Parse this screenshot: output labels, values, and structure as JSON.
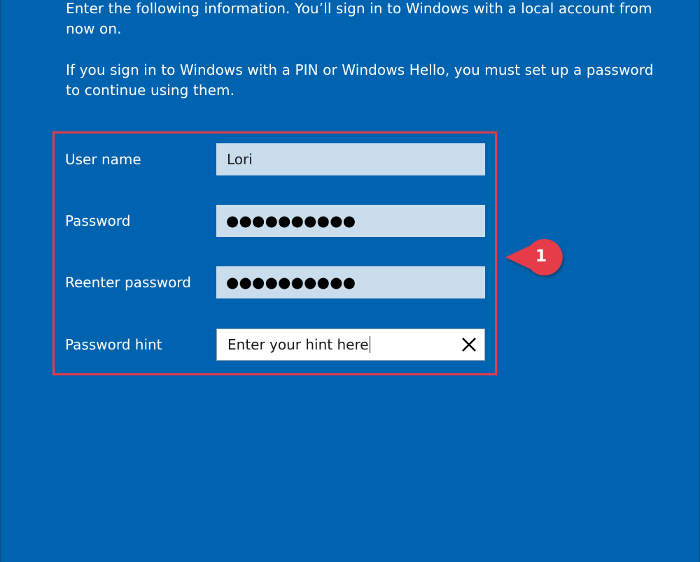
{
  "intro": {
    "paragraph1": "Enter the following information. You’ll sign in to Windows with a local account from now on.",
    "paragraph2": "If you sign in to Windows with a PIN or Windows Hello, you must set up a password to continue using them."
  },
  "form": {
    "username": {
      "label": "User name",
      "value": "Lori"
    },
    "password": {
      "label": "Password",
      "masked_value": "●●●●●●●●●●"
    },
    "reenter_password": {
      "label": "Reenter password",
      "masked_value": "●●●●●●●●●●"
    },
    "password_hint": {
      "label": "Password hint",
      "value": "Enter your hint here",
      "clear_icon": "close-icon"
    }
  },
  "annotation": {
    "step_number": "1",
    "color": "#e63a4a"
  },
  "colors": {
    "background": "#0063af",
    "field_fill": "#c9ddec",
    "active_field_fill": "#ffffff",
    "highlight_border": "#e63a4a"
  }
}
